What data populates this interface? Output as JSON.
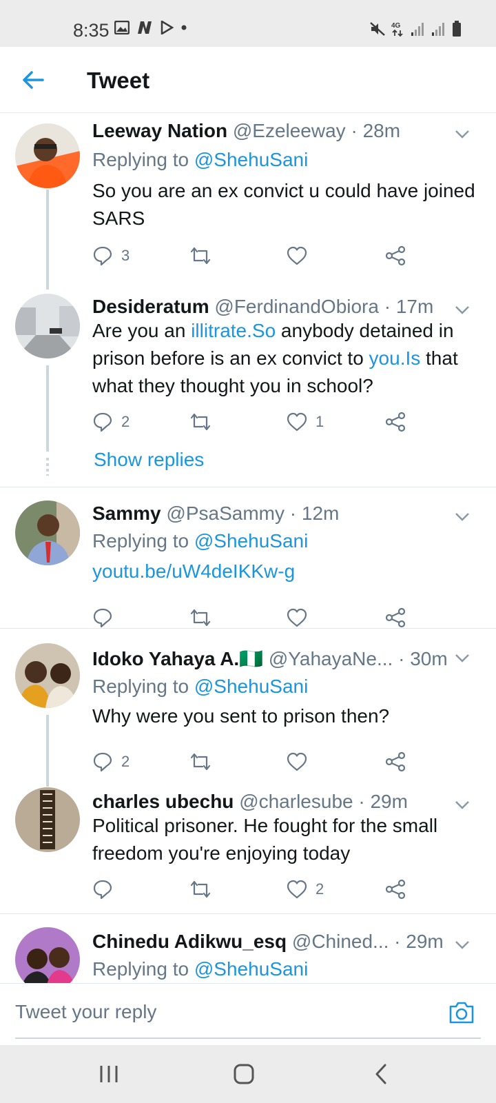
{
  "status_bar": {
    "time": "8:35",
    "network": "4G"
  },
  "header": {
    "title": "Tweet"
  },
  "tweets": [
    {
      "name": "Leeway Nation",
      "handle": "@Ezeleeway",
      "time": "· 28m",
      "replying_prefix": "Replying to",
      "replying_to": "@ShehuSani",
      "text": "So you are an ex convict u could have joined SARS",
      "replies": "3",
      "retweets": "",
      "likes": ""
    },
    {
      "name": "Desideratum",
      "handle": "@FerdinandObiora",
      "time": "· 17m",
      "text_parts": [
        "Are you an ",
        "illitrate.So",
        " anybody detained in prison before is an ex convict to ",
        "you.Is",
        " that what they thought you in school?"
      ],
      "replies": "2",
      "retweets": "",
      "likes": "1",
      "show_replies": "Show replies"
    },
    {
      "name": "Sammy",
      "handle": "@PsaSammy",
      "time": "· 12m",
      "replying_prefix": "Replying to",
      "replying_to": "@ShehuSani",
      "link": "youtu.be/uW4deIKKw-g",
      "replies": "",
      "retweets": "",
      "likes": ""
    },
    {
      "name": "Idoko Yahaya A.",
      "flag": "🇳🇬",
      "handle": "@YahayaNe...",
      "time": "· 30m",
      "replying_prefix": "Replying to",
      "replying_to": "@ShehuSani",
      "text": "Why were you sent to prison then?",
      "replies": "2",
      "retweets": "",
      "likes": ""
    },
    {
      "name": "charles ubechu",
      "handle": "@charlesube",
      "time": "· 29m",
      "text": "Political prisoner. He fought for the small freedom you're enjoying today",
      "replies": "",
      "retweets": "",
      "likes": "2"
    },
    {
      "name": "Chinedu Adikwu_esq",
      "handle": "@Chined...",
      "time": "· 29m",
      "replying_prefix": "Replying to",
      "replying_to": "@ShehuSani"
    }
  ],
  "composer": {
    "placeholder": "Tweet your reply"
  },
  "colors": {
    "accent": "#1b95e0",
    "text": "#14171a",
    "muted": "#657786",
    "divider": "#e1e8ed"
  }
}
